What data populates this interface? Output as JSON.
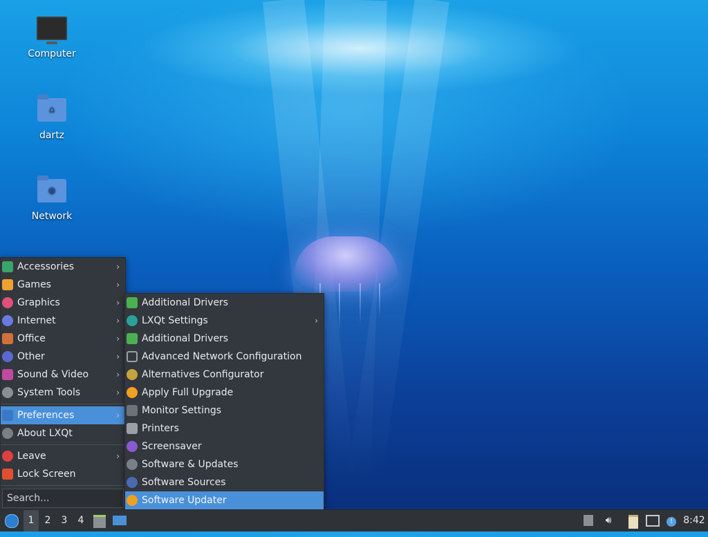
{
  "desktop": {
    "icons": [
      {
        "label": "Computer",
        "icon": "computer-icon"
      },
      {
        "label": "dartz",
        "icon": "home-folder-icon"
      },
      {
        "label": "Network",
        "icon": "network-folder-icon"
      }
    ]
  },
  "main_menu": {
    "categories": [
      {
        "label": "Accessories",
        "icon": "accessories-icon",
        "color": "#3aa56a"
      },
      {
        "label": "Games",
        "icon": "games-icon",
        "color": "#f0a030"
      },
      {
        "label": "Graphics",
        "icon": "graphics-icon",
        "color": "#e0507a"
      },
      {
        "label": "Internet",
        "icon": "internet-icon",
        "color": "#6a7ae0"
      },
      {
        "label": "Office",
        "icon": "office-icon",
        "color": "#d0703a"
      },
      {
        "label": "Other",
        "icon": "other-icon",
        "color": "#5a6ad0"
      },
      {
        "label": "Sound & Video",
        "icon": "sound-video-icon",
        "color": "#c04aa0"
      },
      {
        "label": "System Tools",
        "icon": "system-tools-icon",
        "color": "#8a8f96"
      }
    ],
    "preferences": "Preferences",
    "about": "About LXQt",
    "leave": "Leave",
    "lock_screen": "Lock Screen",
    "search_placeholder": "Search..."
  },
  "preferences_menu": {
    "items": [
      {
        "label": "Additional Drivers",
        "icon": "chip-icon",
        "color": "#4caf50",
        "submenu": false
      },
      {
        "label": "LXQt Settings",
        "icon": "lxqt-settings-icon",
        "color": "#2aa198",
        "submenu": true
      },
      {
        "label": "Additional Drivers",
        "icon": "chip-icon",
        "color": "#4caf50",
        "submenu": false
      },
      {
        "label": "Advanced Network Configuration",
        "icon": "network-config-icon",
        "color": "#9aa0a6",
        "submenu": false
      },
      {
        "label": "Alternatives Configurator",
        "icon": "alternatives-icon",
        "color": "#c8a23c",
        "submenu": false
      },
      {
        "label": "Apply Full Upgrade",
        "icon": "upgrade-icon",
        "color": "#f0a020",
        "submenu": false
      },
      {
        "label": "Monitor Settings",
        "icon": "monitor-icon",
        "color": "#6c7278",
        "submenu": false
      },
      {
        "label": "Printers",
        "icon": "printer-icon",
        "color": "#9aa0a6",
        "submenu": false
      },
      {
        "label": "Screensaver",
        "icon": "screensaver-icon",
        "color": "#8a5ad0",
        "submenu": false
      },
      {
        "label": "Software & Updates",
        "icon": "software-updates-icon",
        "color": "#7a8088",
        "submenu": false
      },
      {
        "label": "Software Sources",
        "icon": "software-sources-icon",
        "color": "#4a6ab0",
        "submenu": false
      },
      {
        "label": "Software Updater",
        "icon": "updater-icon",
        "color": "#f0a020",
        "submenu": false
      }
    ],
    "selected_index": 11
  },
  "taskbar": {
    "workspaces": [
      "1",
      "2",
      "3",
      "4"
    ],
    "active_workspace": "1",
    "clock": "8:42"
  },
  "colors": {
    "accent": "#4a90d9",
    "menu_bg": "#33373e",
    "panel_bg": "#2f3237"
  }
}
